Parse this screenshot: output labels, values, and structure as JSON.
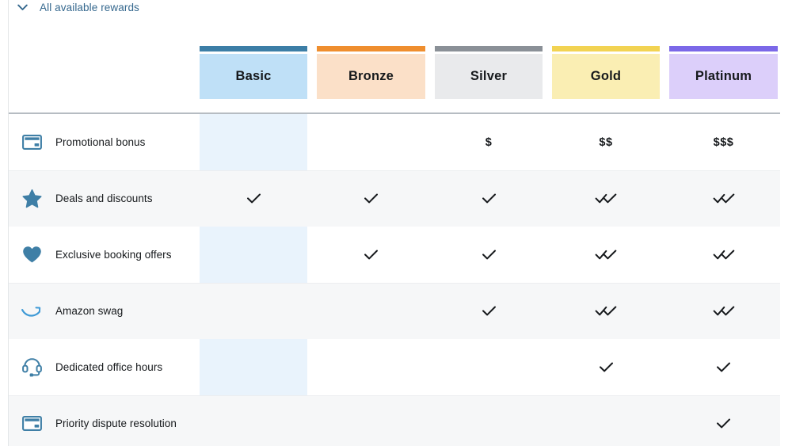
{
  "disclosure": {
    "label": "All available rewards",
    "icon": "chevron-down-icon",
    "expanded": true,
    "link_color": "#35688e"
  },
  "table": {
    "columns": [
      {
        "id": "basic",
        "label": "Basic",
        "bar_color": "#3c7ea6",
        "body_color": "#bfe0f7",
        "highlighted": true
      },
      {
        "id": "bronze",
        "label": "Bronze",
        "bar_color": "#ef8e2e",
        "body_color": "#fbe0c8",
        "highlighted": false
      },
      {
        "id": "silver",
        "label": "Silver",
        "bar_color": "#8a9097",
        "body_color": "#e9eaec",
        "highlighted": false
      },
      {
        "id": "gold",
        "label": "Gold",
        "bar_color": "#f2d352",
        "body_color": "#faeeb3",
        "highlighted": false
      },
      {
        "id": "platinum",
        "label": "Platinum",
        "bar_color": "#7b68e8",
        "body_color": "#dccffa",
        "highlighted": false
      }
    ],
    "rows": [
      {
        "label": "Promotional bonus",
        "icon": "credit-card-icon",
        "cells": [
          "",
          "",
          "$",
          "$$",
          "$$$"
        ]
      },
      {
        "label": "Deals and discounts",
        "icon": "star-icon",
        "cells": [
          "check",
          "check",
          "check",
          "double-check",
          "double-check"
        ]
      },
      {
        "label": "Exclusive booking offers",
        "icon": "heart-icon",
        "cells": [
          "",
          "check",
          "check",
          "double-check",
          "double-check"
        ]
      },
      {
        "label": "Amazon swag",
        "icon": "amazon-smile-icon",
        "cells": [
          "",
          "",
          "check",
          "double-check",
          "double-check"
        ]
      },
      {
        "label": "Dedicated office hours",
        "icon": "headset-icon",
        "cells": [
          "",
          "",
          "",
          "check",
          "check"
        ]
      },
      {
        "label": "Priority dispute resolution",
        "icon": "credit-card-icon",
        "cells": [
          "",
          "",
          "",
          "",
          "check"
        ]
      }
    ]
  },
  "theme": {
    "icon_blue": "#3f7fa6",
    "stripe": "#f6f7f8",
    "basic_highlight": "#e9f3fc",
    "separator": "#b6bcc2",
    "text": "#16191c"
  }
}
